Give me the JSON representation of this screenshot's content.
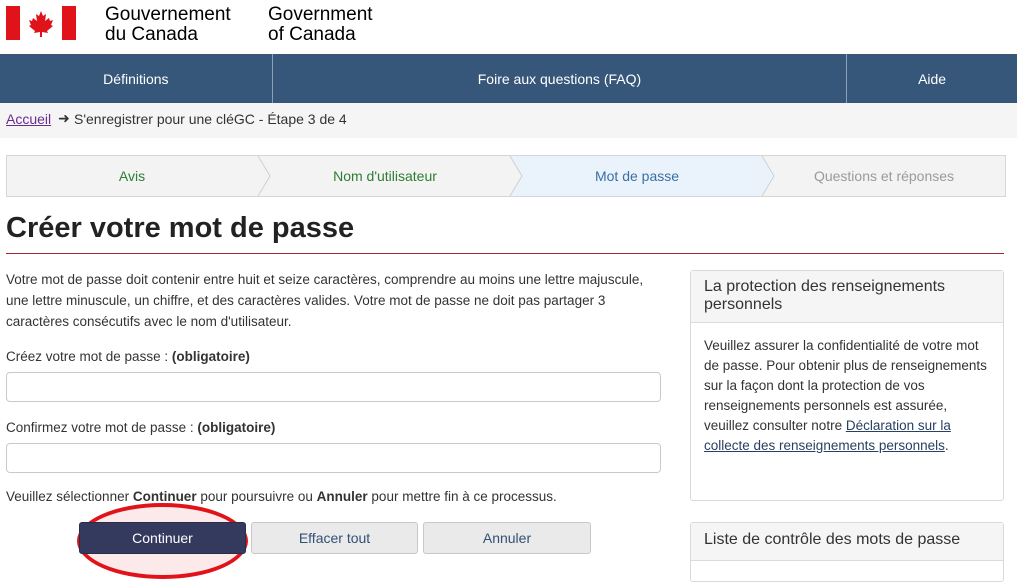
{
  "header": {
    "signature_fr_line1": "Gouvernement",
    "signature_fr_line2": "du Canada",
    "signature_en_line1": "Government",
    "signature_en_line2": "of Canada",
    "flag_icon": "canada-flag-icon"
  },
  "menu": {
    "definitions": "Définitions",
    "faq": "Foire aux questions (FAQ)",
    "aide": "Aide"
  },
  "breadcrumb": {
    "home": "Accueil",
    "arrow": "➜",
    "current": "S'enregistrer pour une cléGC - Étape 3 de 4"
  },
  "steps": [
    {
      "label": "Avis",
      "state": "complete"
    },
    {
      "label": "Nom d'utilisateur",
      "state": "complete"
    },
    {
      "label": "Mot de passe",
      "state": "current"
    },
    {
      "label": "Questions et réponses",
      "state": "upcoming"
    }
  ],
  "main": {
    "title": "Créer votre mot de passe",
    "intro": "Votre mot de passe doit contenir entre huit et seize caractères, comprendre au moins une lettre majuscule, une lettre minuscule, un chiffre, et des caractères valides. Votre mot de passe ne doit pas partager 3 caractères consécutifs avec le nom d'utilisateur.",
    "password_label": "Créez votre mot de passe : ",
    "password_required": "(obligatoire)",
    "password_value": "",
    "confirm_label": "Confirmez votre mot de passe : ",
    "confirm_required": "(obligatoire)",
    "confirm_value": "",
    "instruction_pre": "Veuillez sélectionner ",
    "instruction_continue": "Continuer",
    "instruction_mid": " pour poursuivre ou ",
    "instruction_cancel": "Annuler",
    "instruction_post": " pour mettre fin à ce processus."
  },
  "buttons": {
    "continue": "Continuer",
    "clear": "Effacer tout",
    "cancel": "Annuler"
  },
  "privacy_panel": {
    "heading": "La protection des renseignements personnels",
    "body": "Veuillez assurer la confidentialité de votre mot de passe. Pour obtenir plus de renseignements sur la façon dont la protection de vos renseignements personnels est assurée, veuillez consulter notre ",
    "link": "Déclaration sur la collecte des renseignements personnels",
    "end": "."
  },
  "checklist_panel": {
    "heading": "Liste de contrôle des mots de passe"
  },
  "colors": {
    "menu_bg": "#36577a",
    "title_rule": "#a3272f",
    "highlight_ring": "#e0131b",
    "primary_button": "#34395e"
  }
}
